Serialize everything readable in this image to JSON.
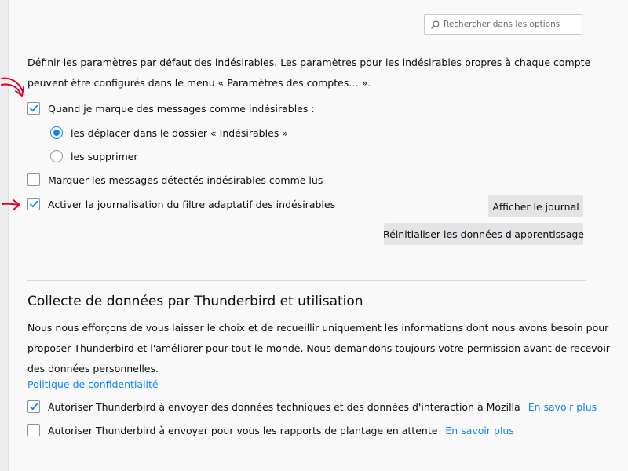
{
  "search": {
    "placeholder": "Rechercher dans les options"
  },
  "junk": {
    "description_line1": "Définir les paramètres par défaut des indésirables. Les paramètres pour les indésirables propres à chaque compte",
    "description_line2": "peuvent être configurés dans le menu « Paramètres des comptes… ».",
    "mark_junk": {
      "label": "Quand je marque des messages comme indésirables :",
      "checked": true
    },
    "move_option": {
      "label": "les déplacer dans le dossier « Indésirables »",
      "selected": true
    },
    "delete_option": {
      "label": "les supprimer",
      "selected": false
    },
    "mark_read": {
      "label": "Marquer les messages détectés indésirables comme lus",
      "checked": false
    },
    "logging": {
      "label": "Activer la journalisation du filtre adaptatif des indésirables",
      "checked": true
    },
    "show_log_button": "Afficher le journal",
    "reset_training_button": "Réinitialiser les données d'apprentissage"
  },
  "data_collection": {
    "heading": "Collecte de données par Thunderbird et utilisation",
    "description_line1": "Nous nous efforçons de vous laisser le choix et de recueillir uniquement les informations dont nous avons besoin pour",
    "description_line2": "proposer Thunderbird et l'améliorer pour tout le monde. Nous demandons toujours votre permission avant de recevoir",
    "description_line3": "des données personnelles.",
    "privacy_link": "Politique de confidentialité",
    "telemetry": {
      "label": "Autoriser Thunderbird à envoyer des données techniques et des données d'interaction à Mozilla",
      "checked": true,
      "learn_more": "En savoir plus"
    },
    "crash_reports": {
      "label": "Autoriser Thunderbird à envoyer pour vous les rapports de plantage en attente",
      "checked": false,
      "learn_more": "En savoir plus"
    }
  },
  "colors": {
    "accent": "#0a84ff",
    "annotation": "#e0002a",
    "background": "#f9f9fa",
    "button": "#e4e4e6"
  }
}
